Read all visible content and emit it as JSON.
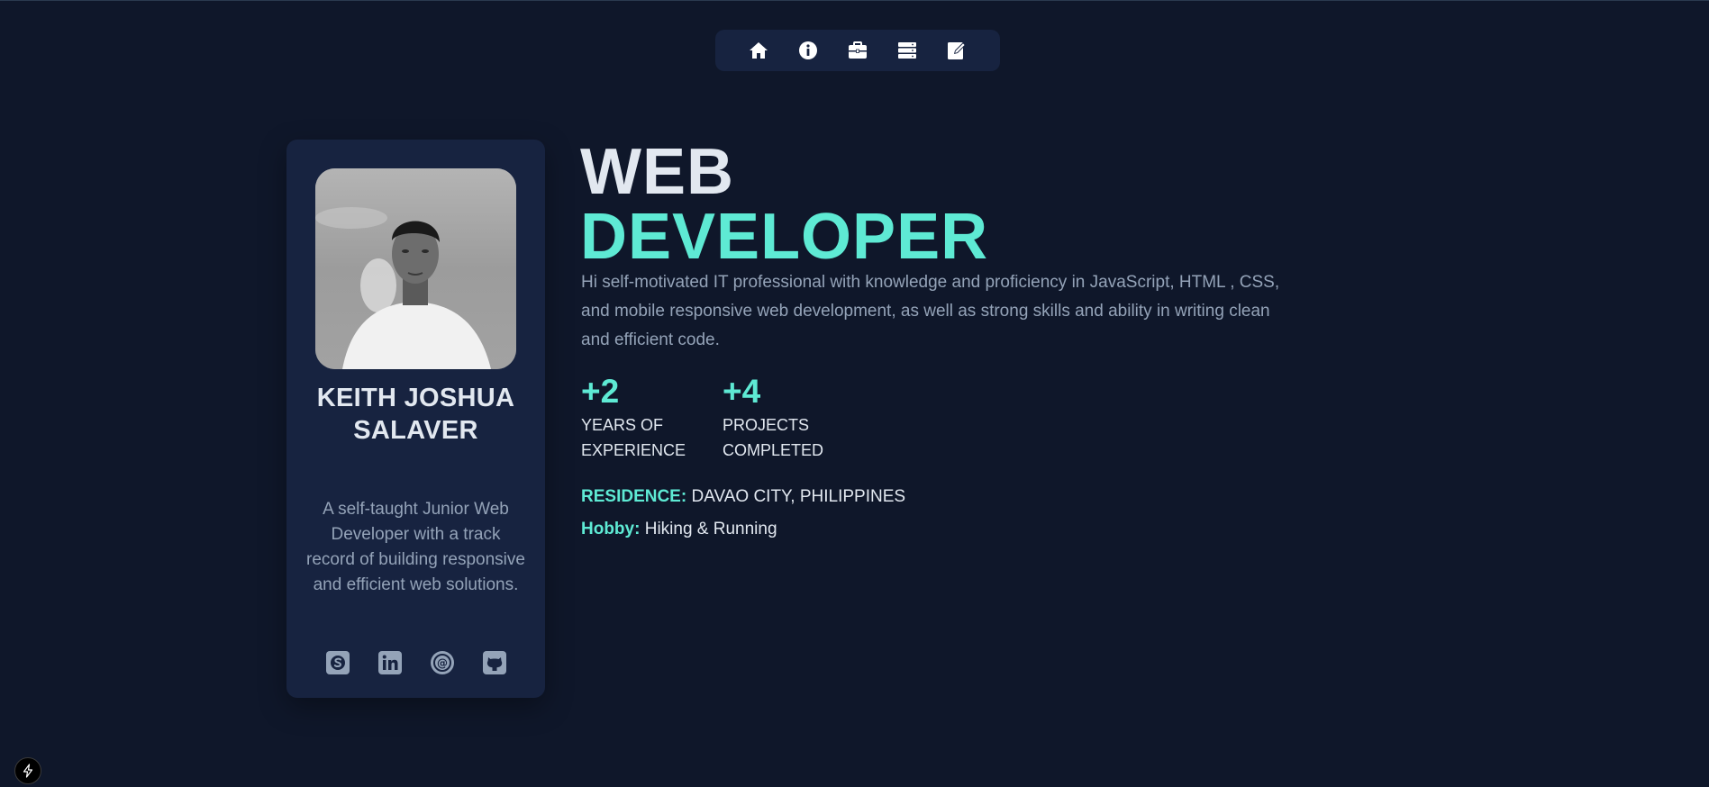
{
  "nav": {
    "items": [
      {
        "icon": "home-icon",
        "label": "home"
      },
      {
        "icon": "info-icon",
        "label": "about"
      },
      {
        "icon": "briefcase-icon",
        "label": "experience"
      },
      {
        "icon": "server-icon",
        "label": "projects"
      },
      {
        "icon": "edit-icon",
        "label": "contact"
      }
    ]
  },
  "profile": {
    "name_line1": "KEITH JOSHUA",
    "name_line2": "SALAVER",
    "bio": "A self-taught Junior Web Developer with a track record of building responsive and efficient web solutions.",
    "socials": [
      "skype-icon",
      "linkedin-icon",
      "email-at-icon",
      "github-icon"
    ]
  },
  "hero": {
    "title_line1": "WEB",
    "title_line2": "DEVELOPER",
    "intro": "Hi self-motivated IT professional with knowledge and proficiency in JavaScript, HTML , CSS, and mobile responsive web development, as well as strong skills and ability in writing clean and efficient code."
  },
  "stats": [
    {
      "value": "+2",
      "label_line1": "YEARS OF",
      "label_line2": "EXPERIENCE"
    },
    {
      "value": "+4",
      "label_line1": "PROJECTS",
      "label_line2": "COMPLETED"
    }
  ],
  "info": {
    "residence_key": "RESIDENCE:",
    "residence_value": "DAVAO CITY, PHILIPPINES",
    "hobby_key": "Hobby:",
    "hobby_value": "Hiking & Running"
  },
  "colors": {
    "background": "#0f172a",
    "card": "#172340",
    "accent": "#5eead4",
    "text": "#e2e8f0",
    "muted": "#94a3b8"
  }
}
